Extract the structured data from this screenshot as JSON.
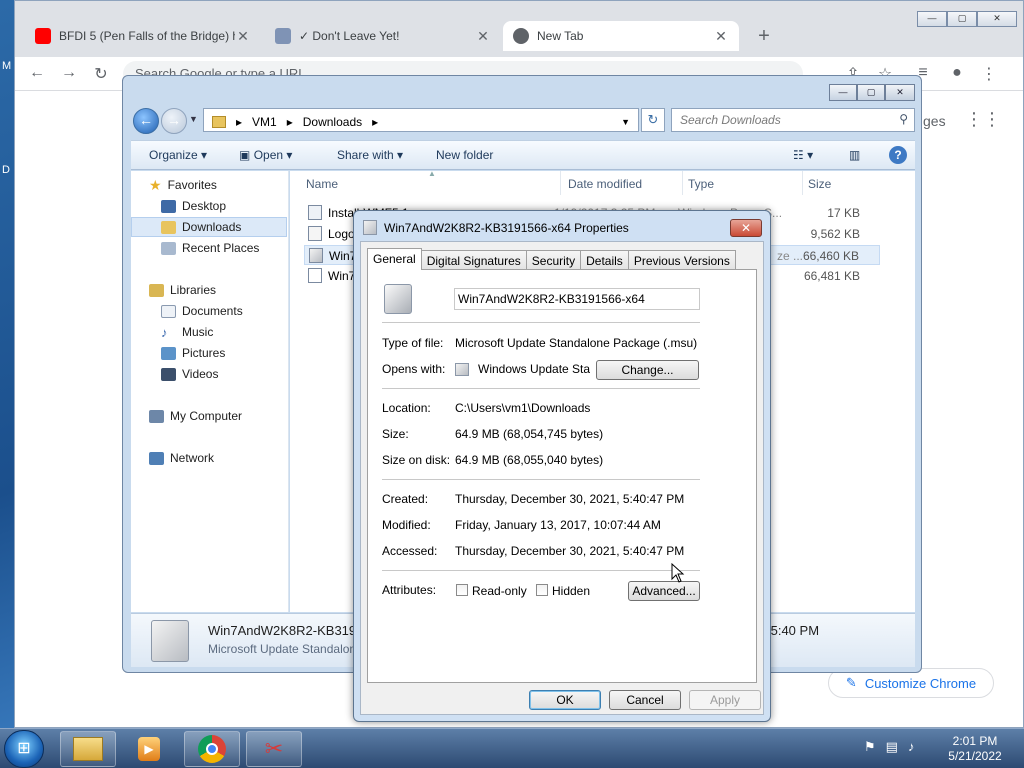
{
  "chrome": {
    "tabs": [
      {
        "title": "BFDI 5 (Pen Falls of the Bridge) h",
        "close": "✕"
      },
      {
        "title": "✓ Don't Leave Yet!",
        "close": "✕"
      },
      {
        "title": "New Tab",
        "close": "✕"
      }
    ],
    "new_tab": "+",
    "omnibox_placeholder": "Search Google or type a URL",
    "images_link": "ges",
    "customize_label": "Customize Chrome"
  },
  "explorer": {
    "breadcrumb": [
      "VM1",
      "Downloads"
    ],
    "search_placeholder": "Search Downloads",
    "commands": {
      "organize": "Organize",
      "open": "Open",
      "share": "Share with",
      "new_folder": "New folder"
    },
    "nav": {
      "favorites": "Favorites",
      "desktop": "Desktop",
      "downloads": "Downloads",
      "recent": "Recent Places",
      "libraries": "Libraries",
      "documents": "Documents",
      "music": "Music",
      "pictures": "Pictures",
      "videos": "Videos",
      "computer": "My Computer",
      "network": "Network"
    },
    "columns": {
      "name": "Name",
      "date": "Date modified",
      "type": "Type",
      "size": "Size"
    },
    "files": [
      {
        "name": "Install-WMF5.1",
        "date": "1/19/2017 3:25 PM",
        "type": "Windows PowerS...",
        "size": "17 KB"
      },
      {
        "name": "Logo",
        "date": "",
        "type": "",
        "size": "9,562 KB"
      },
      {
        "name": "Win7",
        "date": "",
        "type": "ze ...",
        "size": "66,460 KB"
      },
      {
        "name": "Win7",
        "date": "",
        "type": "",
        "size": "66,481 KB"
      }
    ],
    "details": {
      "name": "Win7AndW2K8R2-KB3191",
      "type": "Microsoft Update Standalon",
      "time": ":5:40 PM"
    }
  },
  "dialog": {
    "title": "Win7AndW2K8R2-KB3191566-x64 Properties",
    "close": "✕",
    "tabs": [
      "General",
      "Digital Signatures",
      "Security",
      "Details",
      "Previous Versions"
    ],
    "filename": "Win7AndW2K8R2-KB3191566-x64",
    "type_label": "Type of file:",
    "type_value": "Microsoft Update Standalone Package (.msu)",
    "opens_label": "Opens with:",
    "opens_value": "Windows Update Stand",
    "change_button": "Change...",
    "location_label": "Location:",
    "location_value": "C:\\Users\\vm1\\Downloads",
    "size_label": "Size:",
    "size_value": "64.9 MB (68,054,745 bytes)",
    "disk_label": "Size on disk:",
    "disk_value": "64.9 MB (68,055,040 bytes)",
    "created_label": "Created:",
    "created_value": "Thursday, December 30, 2021, 5:40:47 PM",
    "modified_label": "Modified:",
    "modified_value": "Friday, January 13, 2017, 10:07:44 AM",
    "accessed_label": "Accessed:",
    "accessed_value": "Thursday, December 30, 2021, 5:40:47 PM",
    "attributes_label": "Attributes:",
    "readonly_label": "Read-only",
    "hidden_label": "Hidden",
    "advanced_button": "Advanced...",
    "ok_button": "OK",
    "cancel_button": "Cancel",
    "apply_button": "Apply"
  },
  "taskbar": {
    "time": "2:01 PM",
    "date": "5/21/2022"
  },
  "colors": {
    "accent": "#1a73e8",
    "youtube": "#ff0000",
    "dialog_close": "#c94a35"
  }
}
